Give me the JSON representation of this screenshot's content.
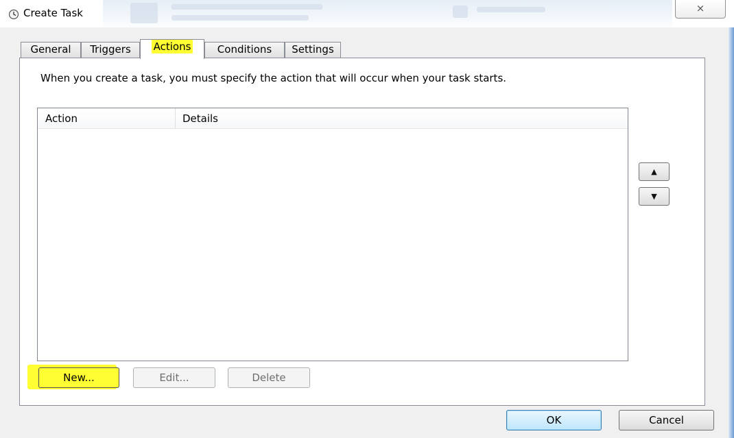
{
  "window": {
    "title": "Create Task",
    "close_glyph": "⨯"
  },
  "tabs": [
    {
      "label": "General"
    },
    {
      "label": "Triggers"
    },
    {
      "label": "Actions"
    },
    {
      "label": "Conditions"
    },
    {
      "label": "Settings"
    }
  ],
  "active_tab": "Actions",
  "panel": {
    "description": "When you create a task, you must specify the action that will occur when your task starts."
  },
  "list": {
    "columns": [
      "Action",
      "Details"
    ],
    "rows": []
  },
  "move_buttons": {
    "up_glyph": "▲",
    "down_glyph": "▼"
  },
  "buttons": {
    "new": "New...",
    "edit": "Edit...",
    "delete": "Delete",
    "ok": "OK",
    "cancel": "Cancel"
  },
  "colors": {
    "highlight": "#ffff33",
    "frame_bg": "#f0f0f0",
    "panel_bg": "#ffffff",
    "default_button_border": "#3c7fb1"
  },
  "icons": {
    "title": "clock-icon",
    "move_up": "arrow-up-icon",
    "move_down": "arrow-down-icon"
  }
}
